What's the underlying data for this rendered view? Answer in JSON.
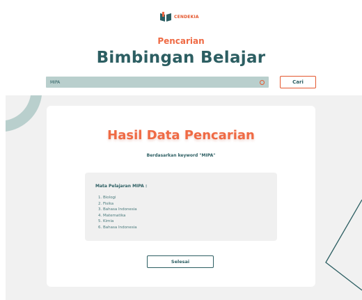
{
  "header": {
    "logo_text": "CENDEKIA",
    "subtitle": "Pencarian",
    "title": "Bimbingan Belajar"
  },
  "search": {
    "value": "MIPA",
    "button_label": "Cari"
  },
  "result": {
    "title": "Hasil Data Pencarian",
    "subtitle": "Berdasarkan keyword \"MIPA\"",
    "list_heading": "Mata Pelajaran MIPA :",
    "items": [
      "1. Biologi",
      "2. Fisika",
      "3. Bahasa Indonesia",
      "4. Matematika",
      "5. Kimia",
      "6. Bahasa Indonesia"
    ],
    "done_label": "Selesai"
  },
  "colors": {
    "accent": "#ef6a44",
    "primary": "#2c5e62",
    "search_bg": "#b9cfcd"
  }
}
